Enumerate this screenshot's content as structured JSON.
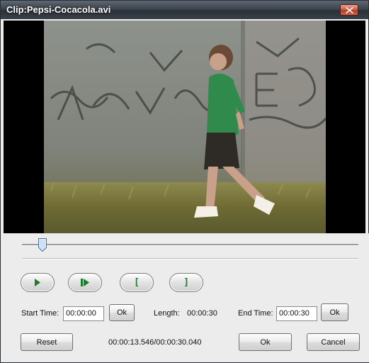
{
  "window": {
    "title": "Clip:Pepsi-Cocacola.avi"
  },
  "icons": {
    "close": "close-icon",
    "play": "play-icon",
    "step": "step-forward-icon",
    "mark_in": "mark-in-icon",
    "mark_out": "mark-out-icon"
  },
  "playback": {
    "position_fraction": 0.451
  },
  "controls": {
    "start_label": "Start Time:",
    "start_value": "00:00:00",
    "start_ok": "Ok",
    "length_label": "Length:",
    "length_value": "00:00:30",
    "end_label": "End Time:",
    "end_value": "00:00:30",
    "end_ok": "Ok",
    "mark_in_glyph": "[",
    "mark_out_glyph": "]"
  },
  "footer": {
    "reset": "Reset",
    "time_readout": "00:00:13.546/00:00:30.040",
    "ok": "Ok",
    "cancel": "Cancel"
  },
  "colors": {
    "accent_green": "#1f7a2e",
    "titlebar": "#3d444d",
    "close_red": "#c8553e"
  }
}
